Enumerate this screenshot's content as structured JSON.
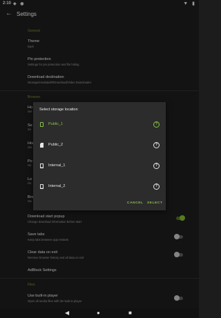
{
  "status_bar": {
    "time": "2:10",
    "left_icons": "◈ ◉",
    "right_icons": "▼ ▮"
  },
  "header": {
    "title": "Settings"
  },
  "sections": {
    "general": "General",
    "browser": "Browser",
    "files": "Files"
  },
  "general_items": [
    {
      "title": "Theme",
      "subtitle": "Dark"
    },
    {
      "title": "Pin protection",
      "subtitle": "Settings for pin protection and file hiding"
    },
    {
      "title": "Download destination",
      "subtitle": "/storage/emulated/0/Download/Video Downloader"
    }
  ],
  "browser_items_partial": [
    {
      "title": "Ho",
      "subtitle": "Set"
    },
    {
      "title": "Se",
      "subtitle": "Se"
    },
    {
      "title": "His",
      "subtitle": "Set"
    },
    {
      "title": "Po",
      "subtitle": "Ho"
    },
    {
      "title": "Lo",
      "subtitle": "Ho"
    },
    {
      "title": "Bro",
      "subtitle": "Sw"
    }
  ],
  "browser_items": [
    {
      "title": "Download start popup",
      "subtitle": "Change download information before start",
      "toggle": "on"
    },
    {
      "title": "Save tabs",
      "subtitle": "Keep tabs between app restarts",
      "toggle": "off"
    },
    {
      "title": "Clear data on exit",
      "subtitle": "Remove browser history and all data on exit",
      "toggle": "off"
    },
    {
      "title": "AdBlock Settings"
    }
  ],
  "files_items": [
    {
      "title": "Use built-in player",
      "subtitle": "Open all media files with the built-in player",
      "toggle": "off"
    }
  ],
  "dialog": {
    "title": "Select storage location",
    "options": [
      {
        "label": "Public_1",
        "icon": "phone-icon",
        "selected": true
      },
      {
        "label": "Public_2",
        "icon": "sd-card-icon",
        "selected": false
      },
      {
        "label": "Internal_1",
        "icon": "phone-icon",
        "selected": false
      },
      {
        "label": "Internal_2",
        "icon": "phone-icon",
        "selected": false
      }
    ],
    "cancel_label": "CANCEL",
    "select_label": "SELECT"
  },
  "nav": {
    "back": "◀",
    "home": "●",
    "recents": "■"
  },
  "colors": {
    "accent": "#8bc34a",
    "background": "#1c1c1c",
    "dialog": "#2c2c2c"
  }
}
